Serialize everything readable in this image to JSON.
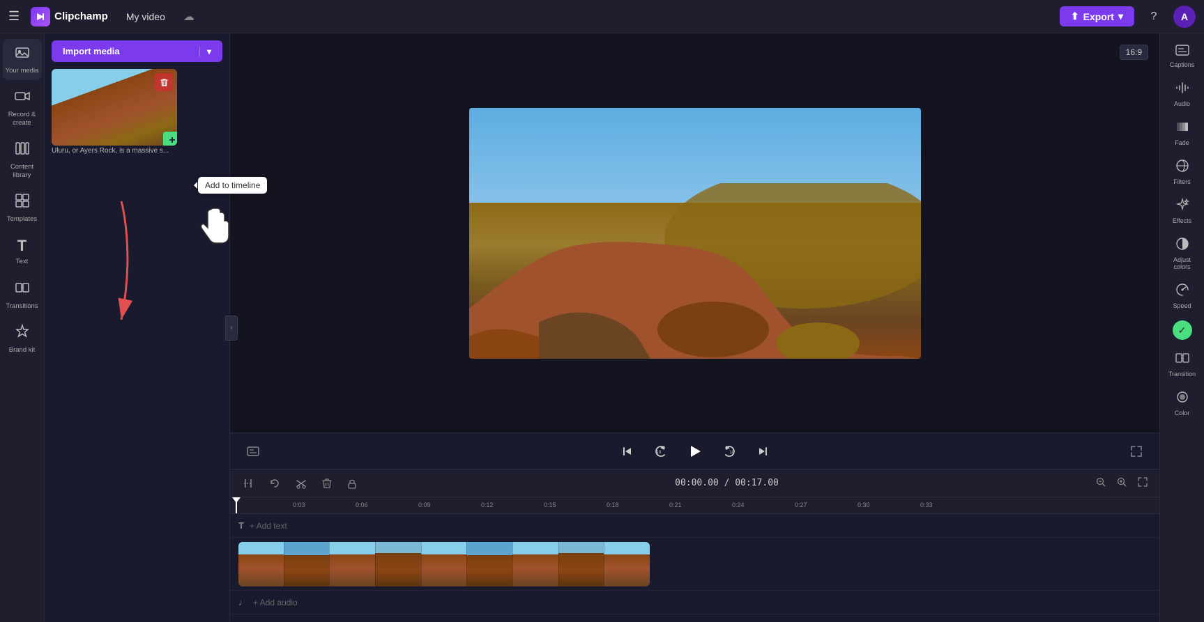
{
  "topbar": {
    "menu_icon": "☰",
    "logo_text": "Clipchamp",
    "video_title": "My video",
    "cloud_icon": "☁",
    "export_label": "Export",
    "export_caret": "▾",
    "help_icon": "?",
    "avatar_initial": "A"
  },
  "left_sidebar": {
    "items": [
      {
        "id": "your-media",
        "icon": "🖼",
        "label": "Your media"
      },
      {
        "id": "record-create",
        "icon": "⏺",
        "label": "Record &\ncreate"
      },
      {
        "id": "content-library",
        "icon": "📚",
        "label": "Content library"
      },
      {
        "id": "templates",
        "icon": "⊞",
        "label": "Templates"
      },
      {
        "id": "text",
        "icon": "T",
        "label": "Text"
      },
      {
        "id": "transitions",
        "icon": "↔",
        "label": "Transitions"
      },
      {
        "id": "brand-kit",
        "icon": "🏷",
        "label": "Brand kit"
      }
    ]
  },
  "media_panel": {
    "import_button_label": "Import media",
    "import_caret": "▾",
    "thumbnail_caption": "Uluru, or Ayers Rock, is a massive s...",
    "tooltip_add": "Add to timeline",
    "delete_icon": "🗑",
    "add_icon": "+"
  },
  "preview": {
    "aspect_ratio": "16:9"
  },
  "video_controls": {
    "skip_back_icon": "⏮",
    "rewind_icon": "↺",
    "play_icon": "▶",
    "forward_icon": "↻",
    "skip_fwd_icon": "⏭",
    "captions_icon": "⊡",
    "fullscreen_icon": "⛶"
  },
  "timeline": {
    "toolbar": {
      "split_icon": "✂+",
      "undo_icon": "↩",
      "cut_icon": "✂",
      "delete_icon": "🗑",
      "lock_icon": "🔒"
    },
    "time_display": "00:00.00",
    "duration_display": "00:17.00",
    "zoom_minus": "−",
    "zoom_plus": "+",
    "zoom_fit": "⊡",
    "ruler_marks": [
      "0:03",
      "0:06",
      "0:09",
      "0:12",
      "0:15",
      "0:18",
      "0:21",
      "0:24",
      "0:27",
      "0:30",
      "0:33"
    ],
    "add_text_label": "+ Add text",
    "add_audio_label": "+ Add audio",
    "text_track_icon": "T",
    "audio_track_icon": "♩"
  },
  "right_sidebar": {
    "items": [
      {
        "id": "captions",
        "icon": "⊡",
        "label": "Captions"
      },
      {
        "id": "audio",
        "icon": "🔊",
        "label": "Audio"
      },
      {
        "id": "fade",
        "icon": "▤",
        "label": "Fade"
      },
      {
        "id": "filters",
        "icon": "⊘",
        "label": "Filters"
      },
      {
        "id": "effects",
        "icon": "✦",
        "label": "Effects"
      },
      {
        "id": "adjust-colors",
        "icon": "◑",
        "label": "Adjust colors"
      },
      {
        "id": "speed",
        "icon": "⚡",
        "label": "Speed"
      },
      {
        "id": "transition",
        "icon": "⊿",
        "label": "Transition"
      },
      {
        "id": "color",
        "icon": "⬤",
        "label": "Color"
      }
    ]
  }
}
